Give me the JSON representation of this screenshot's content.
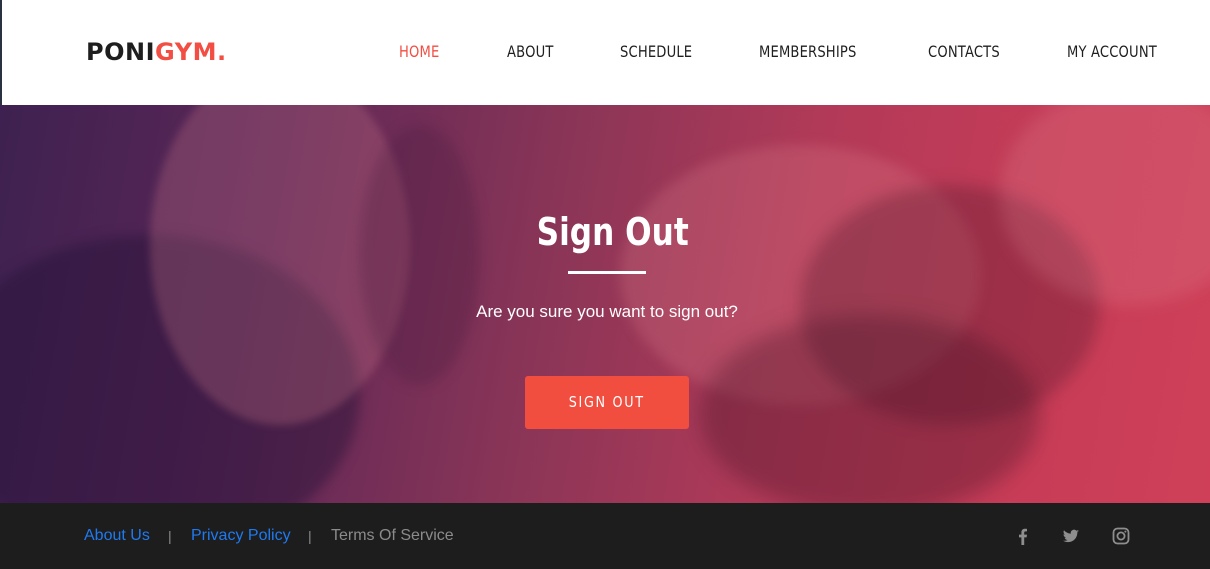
{
  "brand": {
    "part1": "PONI",
    "part2": "GYM.",
    "accent_color": "#f24e43"
  },
  "nav": {
    "items": [
      {
        "label": "HOME",
        "active": true
      },
      {
        "label": "ABOUT",
        "active": false
      },
      {
        "label": "SCHEDULE",
        "active": false
      },
      {
        "label": "MEMBERSHIPS",
        "active": false
      },
      {
        "label": "CONTACTS",
        "active": false
      },
      {
        "label": "MY ACCOUNT",
        "active": false
      }
    ]
  },
  "hero": {
    "title": "Sign Out",
    "subtitle": "Are you sure you want to sign out?",
    "button_label": "SIGN OUT",
    "button_color": "#f24e3f"
  },
  "footer": {
    "links": [
      {
        "label": "About Us"
      },
      {
        "label": "Privacy Policy"
      },
      {
        "label": "Terms Of Service"
      }
    ],
    "separator": "|",
    "social_icons": [
      "facebook-icon",
      "twitter-icon",
      "instagram-icon"
    ],
    "background_color": "#1d1d1d"
  }
}
